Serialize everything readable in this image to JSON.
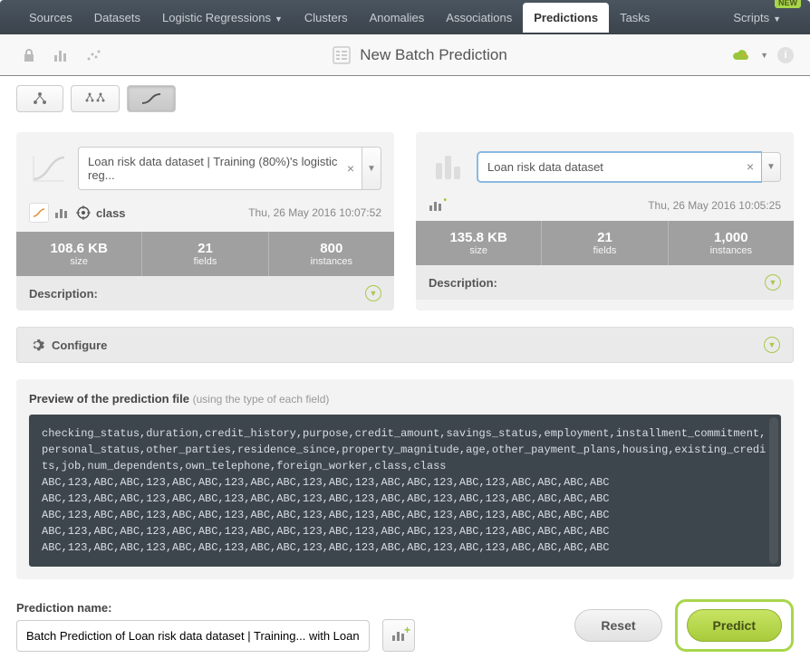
{
  "nav": {
    "items": [
      "Sources",
      "Datasets",
      "Logistic Regressions",
      "Clusters",
      "Anomalies",
      "Associations",
      "Predictions",
      "Tasks"
    ],
    "active": "Predictions",
    "scripts": "Scripts",
    "new_badge": "NEW"
  },
  "header": {
    "title": "New Batch Prediction"
  },
  "cards": {
    "left": {
      "select_value": "Loan risk data dataset | Training (80%)'s logistic reg...",
      "class_label": "class",
      "timestamp": "Thu, 26 May 2016 10:07:52",
      "stats": {
        "size": "108.6 KB",
        "fields": "21",
        "instances": "800"
      },
      "labels": {
        "size": "size",
        "fields": "fields",
        "instances": "instances"
      },
      "description": "Description:"
    },
    "right": {
      "select_value": "Loan risk data dataset",
      "timestamp": "Thu, 26 May 2016 10:05:25",
      "stats": {
        "size": "135.8 KB",
        "fields": "21",
        "instances": "1,000"
      },
      "labels": {
        "size": "size",
        "fields": "fields",
        "instances": "instances"
      },
      "description": "Description:"
    }
  },
  "configure": {
    "label": "Configure"
  },
  "preview": {
    "title": "Preview of the prediction file",
    "subtitle": "(using the type of each field)",
    "lines": [
      "checking_status,duration,credit_history,purpose,credit_amount,savings_status,employment,installment_commitment,personal_status,other_parties,residence_since,property_magnitude,age,other_payment_plans,housing,existing_credits,job,num_dependents,own_telephone,foreign_worker,class,class",
      "ABC,123,ABC,ABC,123,ABC,ABC,123,ABC,ABC,123,ABC,123,ABC,ABC,123,ABC,123,ABC,ABC,ABC,ABC",
      "ABC,123,ABC,ABC,123,ABC,ABC,123,ABC,ABC,123,ABC,123,ABC,ABC,123,ABC,123,ABC,ABC,ABC,ABC",
      "ABC,123,ABC,ABC,123,ABC,ABC,123,ABC,ABC,123,ABC,123,ABC,ABC,123,ABC,123,ABC,ABC,ABC,ABC",
      "ABC,123,ABC,ABC,123,ABC,ABC,123,ABC,ABC,123,ABC,123,ABC,ABC,123,ABC,123,ABC,ABC,ABC,ABC",
      "ABC,123,ABC,ABC,123,ABC,ABC,123,ABC,ABC,123,ABC,123,ABC,ABC,123,ABC,123,ABC,ABC,ABC,ABC"
    ]
  },
  "footer": {
    "name_label": "Prediction name:",
    "name_value": "Batch Prediction of Loan risk data dataset | Training... with Loan",
    "reset": "Reset",
    "predict": "Predict"
  }
}
